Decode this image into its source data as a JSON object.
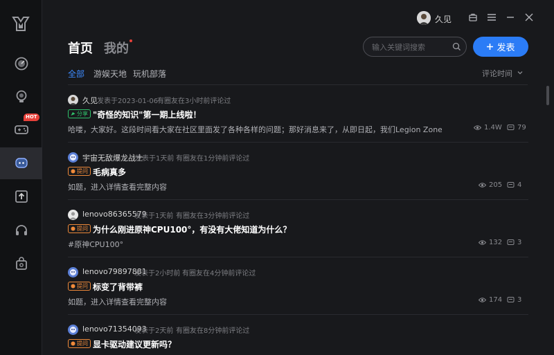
{
  "user": {
    "name": "久见"
  },
  "header": {
    "tabs": [
      {
        "label": "首页",
        "active": true
      },
      {
        "label": "我的",
        "active": false,
        "has_dot": true
      }
    ],
    "search": {
      "placeholder": "输入关键词搜索",
      "value": ""
    },
    "post_button": "发表"
  },
  "subtabs": [
    {
      "label": "全部",
      "active": true
    },
    {
      "label": "游娱天地",
      "active": false
    },
    {
      "label": "玩机部落",
      "active": false
    }
  ],
  "sort": {
    "label": "评论时间"
  },
  "sidebar": {
    "items": [
      {
        "icon": "speedometer-icon",
        "active": false
      },
      {
        "icon": "lightbulb-icon",
        "active": false
      },
      {
        "icon": "gamepad-icon",
        "active": false,
        "badge": "HOT"
      },
      {
        "icon": "community-chat-icon",
        "active": true
      },
      {
        "icon": "upload-icon",
        "active": false
      },
      {
        "icon": "headset-icon",
        "active": false
      },
      {
        "icon": "store-bag-icon",
        "active": false
      }
    ]
  },
  "posts": [
    {
      "author": "久见",
      "posted": "发表于2023-01-06",
      "activity": "有圈友在3小时前评论过",
      "tag": "分享",
      "tag_type": "share",
      "title": "\"奇怪的知识\"第一期上线啦！",
      "body": "哈喽，大家好。这段时间看大家在社区里面发了各种各样的问题；那好消息来了，从即日起，我们Legion Zone运...",
      "views": "1.4W",
      "comments": "79"
    },
    {
      "author": "宇宙无敌爆龙战士",
      "posted": "发表于1天前",
      "activity": "有圈友在1分钟前评论过",
      "tag": "提问",
      "tag_type": "ask",
      "title": "毛病真多",
      "body": "如题，进入详情查看完整内容",
      "views": "205",
      "comments": "4"
    },
    {
      "author": "lenovo86365579",
      "posted": "发表于1天前",
      "activity": "有圈友在3分钟前评论过",
      "tag": "提问",
      "tag_type": "ask",
      "title": "为什么刚进原神CPU100°，有没有大佬知道为什么？",
      "body": "#原神CPU100°",
      "views": "132",
      "comments": "3"
    },
    {
      "author": "lenovo79897881",
      "posted": "发表于2小时前",
      "activity": "有圈友在4分钟前评论过",
      "tag": "提问",
      "tag_type": "ask",
      "title": "标变了背带裤",
      "body": "如题，进入详情查看完整内容",
      "views": "174",
      "comments": "3"
    },
    {
      "author": "lenovo71354093",
      "posted": "发表于2天前",
      "activity": "有圈友在8分钟前评论过",
      "tag": "提问",
      "tag_type": "ask",
      "title": "显卡驱动建议更新吗？",
      "body": "",
      "views": "",
      "comments": ""
    }
  ],
  "colors": {
    "accent": "#2b7cf6",
    "share_tag": "#2fc36b",
    "ask_tag": "#ef8a3a",
    "hot_badge": "#e8413a"
  }
}
